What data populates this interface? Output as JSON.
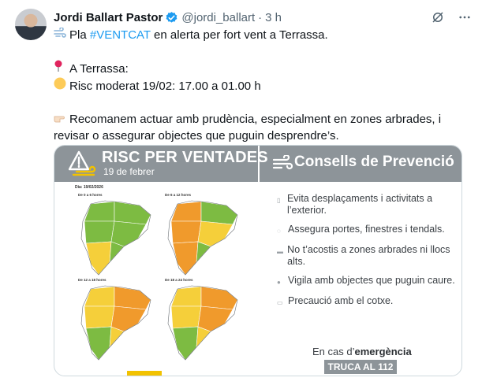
{
  "author": {
    "name": "Jordi Ballart Pastor",
    "handle": "@jordi_ballart",
    "separator": "·",
    "time": "3 h"
  },
  "icons": {
    "verified": "verified-badge-icon",
    "grok": "grok-icon",
    "more": "more-icon",
    "wind": "wind-face-icon",
    "pin": "round-pushpin-icon",
    "circle": "yellow-circle-icon",
    "hand": "pointing-hand-icon"
  },
  "colors": {
    "hashtag": "#1d9bf0",
    "verified": "#1d9bf0",
    "risk_green": "#7dbb42",
    "risk_yellow": "#f5cf3a",
    "risk_orange": "#f09a2c",
    "header_grey": "#8d9499"
  },
  "tweet": {
    "line1_pre": "Pla ",
    "line1_hashtag": "#VENTCAT",
    "line1_post": " en alerta per fort vent a Terrassa.",
    "line2": "A Terrassa:",
    "line3": "Risc moderat 19/02: 17.00 a 01.00 h",
    "line4a": "Recomanem actuar amb prudència, especialment en zones arbrades, i",
    "line4b": "revisar o assegurar objectes que puguin desprendre’s."
  },
  "card": {
    "risk_title": "RISC PER VENTADES",
    "risk_date": "19 de febrer",
    "consells_title": "Consells de Prevenció",
    "map_day": "Dia: 19/02/2026",
    "maps": [
      {
        "label": "De 0 a 6 hores",
        "level": "low"
      },
      {
        "label": "De 6 a 12 hores",
        "level": "mixed"
      },
      {
        "label": "De 12 a 18 hores",
        "level": "high"
      },
      {
        "label": "De 18 a 24 hores",
        "level": "high"
      }
    ],
    "tips": [
      {
        "text": "Evita desplaçaments i activitats a l’exterior.",
        "icon": "door-icon"
      },
      {
        "text": "Assegura portes, finestres i tendals.",
        "icon": "window-icon"
      },
      {
        "text": "No t’acostis a zones arbrades ni llocs alts.",
        "icon": "tree-icon"
      },
      {
        "text": "Vigila amb objectes que puguin caure.",
        "icon": "falling-object-icon"
      },
      {
        "text": "Precaució amb el cotxe.",
        "icon": "car-icon"
      }
    ],
    "emergency_pre": "En cas d’",
    "emergency_bold": "emergència",
    "call": "TRUCA AL 112"
  }
}
